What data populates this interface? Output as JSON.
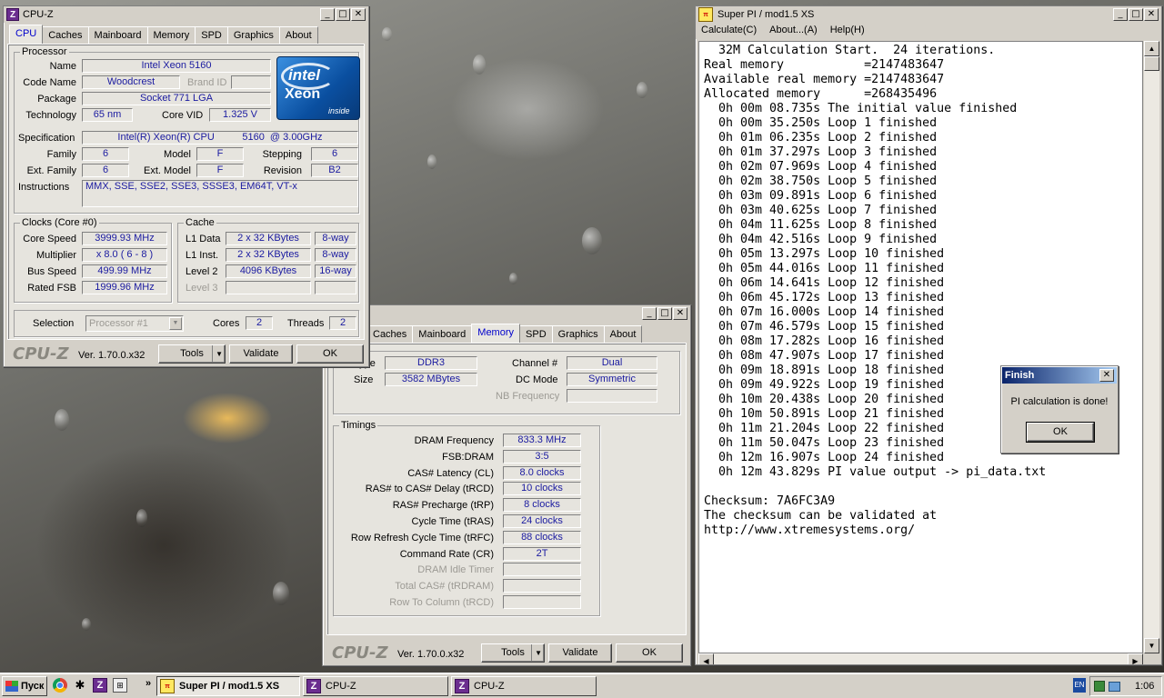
{
  "cpuz1": {
    "title": "CPU-Z",
    "tabs": [
      "CPU",
      "Caches",
      "Mainboard",
      "Memory",
      "SPD",
      "Graphics",
      "About"
    ],
    "active_tab": "CPU",
    "processor": {
      "group": "Processor",
      "name_label": "Name",
      "name": "Intel Xeon 5160",
      "codename_label": "Code Name",
      "codename": "Woodcrest",
      "brandid_label": "Brand ID",
      "brandid": "",
      "package_label": "Package",
      "package": "Socket 771 LGA",
      "technology_label": "Technology",
      "technology": "65 nm",
      "corevid_label": "Core VID",
      "corevid": "1.325 V",
      "spec_label": "Specification",
      "spec": "Intel(R) Xeon(R) CPU          5160  @ 3.00GHz",
      "family_label": "Family",
      "family": "6",
      "model_label": "Model",
      "model": "F",
      "stepping_label": "Stepping",
      "stepping": "6",
      "extfamily_label": "Ext. Family",
      "extfamily": "6",
      "extmodel_label": "Ext. Model",
      "extmodel": "F",
      "revision_label": "Revision",
      "revision": "B2",
      "instructions_label": "Instructions",
      "instructions": "MMX, SSE, SSE2, SSE3, SSSE3, EM64T, VT-x",
      "logo_brand": "intel",
      "logo_product": "Xeon",
      "logo_inside": "inside"
    },
    "clocks": {
      "group": "Clocks (Core #0)",
      "corespeed_label": "Core Speed",
      "corespeed": "3999.93 MHz",
      "multiplier_label": "Multiplier",
      "multiplier": "x 8.0 ( 6 - 8 )",
      "busspeed_label": "Bus Speed",
      "busspeed": "499.99 MHz",
      "ratedfsb_label": "Rated FSB",
      "ratedfsb": "1999.96 MHz"
    },
    "cache": {
      "group": "Cache",
      "l1d_label": "L1 Data",
      "l1d": "2 x 32 KBytes",
      "l1d_way": "8-way",
      "l1i_label": "L1 Inst.",
      "l1i": "2 x 32 KBytes",
      "l1i_way": "8-way",
      "l2_label": "Level 2",
      "l2": "4096 KBytes",
      "l2_way": "16-way",
      "l3_label": "Level 3"
    },
    "selection_label": "Selection",
    "selection": "Processor #1",
    "cores_label": "Cores",
    "cores": "2",
    "threads_label": "Threads",
    "threads": "2",
    "brand": "CPU-Z",
    "version": "Ver. 1.70.0.x32",
    "tools": "Tools",
    "validate": "Validate",
    "ok": "OK"
  },
  "cpuz2": {
    "tabs": [
      "Caches",
      "Mainboard",
      "Memory",
      "SPD",
      "Graphics",
      "About"
    ],
    "active_tab": "Memory",
    "general": {
      "type_label": "Type",
      "type": "DDR3",
      "size_label": "Size",
      "size": "3582 MBytes",
      "channel_label": "Channel #",
      "channel": "Dual",
      "dcmode_label": "DC Mode",
      "dcmode": "Symmetric",
      "nbfreq_label": "NB Frequency",
      "nbfreq": ""
    },
    "timings": {
      "group": "Timings",
      "rows": [
        {
          "label": "DRAM Frequency",
          "value": "833.3 MHz",
          "dim": false
        },
        {
          "label": "FSB:DRAM",
          "value": "3:5",
          "dim": false
        },
        {
          "label": "CAS# Latency (CL)",
          "value": "8.0 clocks",
          "dim": false
        },
        {
          "label": "RAS# to CAS# Delay (tRCD)",
          "value": "10 clocks",
          "dim": false
        },
        {
          "label": "RAS# Precharge (tRP)",
          "value": "8 clocks",
          "dim": false
        },
        {
          "label": "Cycle Time (tRAS)",
          "value": "24 clocks",
          "dim": false
        },
        {
          "label": "Row Refresh Cycle Time (tRFC)",
          "value": "88 clocks",
          "dim": false
        },
        {
          "label": "Command Rate (CR)",
          "value": "2T",
          "dim": false
        },
        {
          "label": "DRAM Idle Timer",
          "value": "",
          "dim": true
        },
        {
          "label": "Total CAS# (tRDRAM)",
          "value": "",
          "dim": true
        },
        {
          "label": "Row To Column (tRCD)",
          "value": "",
          "dim": true
        }
      ]
    },
    "brand": "CPU-Z",
    "version": "Ver. 1.70.0.x32",
    "tools": "Tools",
    "validate": "Validate",
    "ok": "OK"
  },
  "superpi": {
    "title": "Super PI / mod1.5 XS",
    "menu": [
      "Calculate(C)",
      "About...(A)",
      "Help(H)"
    ],
    "lines": [
      "  32M Calculation Start.  24 iterations.",
      "Real memory           =2147483647",
      "Available real memory =2147483647",
      "Allocated memory      =268435496",
      "  0h 00m 08.735s The initial value finished",
      "  0h 00m 35.250s Loop 1 finished",
      "  0h 01m 06.235s Loop 2 finished",
      "  0h 01m 37.297s Loop 3 finished",
      "  0h 02m 07.969s Loop 4 finished",
      "  0h 02m 38.750s Loop 5 finished",
      "  0h 03m 09.891s Loop 6 finished",
      "  0h 03m 40.625s Loop 7 finished",
      "  0h 04m 11.625s Loop 8 finished",
      "  0h 04m 42.516s Loop 9 finished",
      "  0h 05m 13.297s Loop 10 finished",
      "  0h 05m 44.016s Loop 11 finished",
      "  0h 06m 14.641s Loop 12 finished",
      "  0h 06m 45.172s Loop 13 finished",
      "  0h 07m 16.000s Loop 14 finished",
      "  0h 07m 46.579s Loop 15 finished",
      "  0h 08m 17.282s Loop 16 finished",
      "  0h 08m 47.907s Loop 17 finished",
      "  0h 09m 18.891s Loop 18 finished",
      "  0h 09m 49.922s Loop 19 finished",
      "  0h 10m 20.438s Loop 20 finished",
      "  0h 10m 50.891s Loop 21 finished",
      "  0h 11m 21.204s Loop 22 finished",
      "  0h 11m 50.047s Loop 23 finished",
      "  0h 12m 16.907s Loop 24 finished",
      "  0h 12m 43.829s PI value output -> pi_data.txt",
      "",
      "Checksum: 7A6FC3A9",
      "The checksum can be validated at",
      "http://www.xtremesystems.org/"
    ]
  },
  "finish_dialog": {
    "title": "Finish",
    "message": "PI calculation is done!",
    "ok": "OK"
  },
  "taskbar": {
    "start": "Пуск",
    "items": [
      "Super PI / mod1.5 XS",
      "CPU-Z",
      "CPU-Z"
    ],
    "lang": "EN",
    "clock": "1:06"
  },
  "colors": {
    "cpu_purple": "#6b2d8f",
    "value_blue": "#1a1aa0",
    "intel_blue": "#0a5bb0"
  }
}
